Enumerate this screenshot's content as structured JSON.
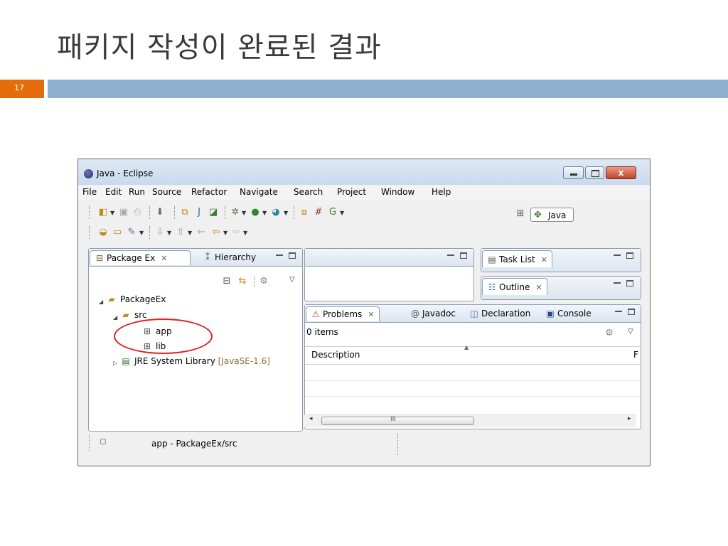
{
  "slide": {
    "title": "패키지 작성이 완료된 결과",
    "page_number": "17",
    "accent_color": "#e46c0a",
    "bar_color": "#8fb0ce"
  },
  "window": {
    "title": "Java - Eclipse",
    "close_label": "x"
  },
  "menu": [
    "File",
    "Edit",
    "Run",
    "Source",
    "Refactor",
    "Navigate",
    "Search",
    "Project",
    "Window",
    "Help"
  ],
  "toolbar": {
    "perspective_label": "Java"
  },
  "package_explorer": {
    "tab1_label": "Package Ex",
    "tab2_label": "Hierarchy",
    "tree": [
      {
        "label": "PackageEx",
        "icon": "project-icon"
      },
      {
        "label": "src",
        "icon": "source-folder-icon"
      },
      {
        "label": "app",
        "icon": "package-icon"
      },
      {
        "label": "lib",
        "icon": "package-icon"
      },
      {
        "label": "JRE System Library",
        "suffix": "[JavaSE-1.6]",
        "icon": "library-icon"
      }
    ]
  },
  "task_list": {
    "tab_label": "Task List"
  },
  "outline": {
    "tab_label": "Outline"
  },
  "bottom_panel": {
    "tabs": [
      "Problems",
      "Javadoc",
      "Declaration",
      "Console"
    ],
    "items_count": "0 items",
    "column_header": "Description",
    "right_col_header": "F",
    "scroll_center": "III"
  },
  "status": {
    "text": "app - PackageEx/src"
  }
}
